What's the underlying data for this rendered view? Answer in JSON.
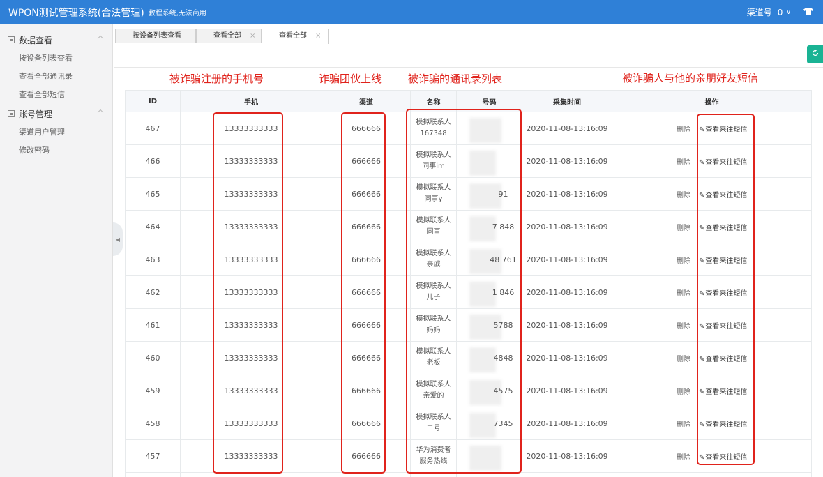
{
  "header": {
    "title": "WPON测试管理系统(合法管理)",
    "subtitle": "教程系统,无法商用",
    "channel_label": "渠道号",
    "channel_value": "0",
    "chevron": "∨"
  },
  "sidebar": {
    "groups": [
      {
        "label": "数据查看",
        "items": [
          "按设备列表查看",
          "查看全部通讯录",
          "查看全部短信"
        ]
      },
      {
        "label": "账号管理",
        "items": [
          "渠道用户管理",
          "修改密码"
        ]
      }
    ]
  },
  "tabs": [
    {
      "label": "按设备列表查看"
    },
    {
      "label": "查看全部",
      "close": "×"
    },
    {
      "label": "查看全部",
      "close": "×"
    }
  ],
  "annotations": {
    "phone": "被诈骗注册的手机号",
    "channel": "诈骗团伙上线",
    "contacts": "被诈骗的通讯录列表",
    "sms": "被诈骗人与他的亲朋好友短信"
  },
  "table": {
    "headers": [
      "ID",
      "手机",
      "渠道",
      "名称",
      "号码",
      "采集时间",
      "操作"
    ],
    "delete_label": "删除",
    "view_label": "查看来往短信",
    "rows": [
      {
        "id": "467",
        "phone": "13333333333",
        "channel": "666666",
        "name_1": "模拟联系人",
        "name_2": "167348",
        "number": "",
        "time": "2020-11-08-13:16:09"
      },
      {
        "id": "466",
        "phone": "13333333333",
        "channel": "666666",
        "name_1": "模拟联系人",
        "name_2": "同事im",
        "number": "",
        "time": "2020-11-08-13:16:09"
      },
      {
        "id": "465",
        "phone": "13333333333",
        "channel": "666666",
        "name_1": "模拟联系人",
        "name_2": "同事y",
        "number": "91",
        "time": "2020-11-08-13:16:09"
      },
      {
        "id": "464",
        "phone": "13333333333",
        "channel": "666666",
        "name_1": "模拟联系人",
        "name_2": "同事",
        "number": "7 848",
        "time": "2020-11-08-13:16:09"
      },
      {
        "id": "463",
        "phone": "13333333333",
        "channel": "666666",
        "name_1": "模拟联系人",
        "name_2": "亲戚",
        "number": "48 761",
        "time": "2020-11-08-13:16:09"
      },
      {
        "id": "462",
        "phone": "13333333333",
        "channel": "666666",
        "name_1": "模拟联系人",
        "name_2": "儿子",
        "number": "1 846",
        "time": "2020-11-08-13:16:09"
      },
      {
        "id": "461",
        "phone": "13333333333",
        "channel": "666666",
        "name_1": "模拟联系人",
        "name_2": "妈妈",
        "number": "5788",
        "time": "2020-11-08-13:16:09"
      },
      {
        "id": "460",
        "phone": "13333333333",
        "channel": "666666",
        "name_1": "模拟联系人",
        "name_2": "老板",
        "number": "4848",
        "time": "2020-11-08-13:16:09"
      },
      {
        "id": "459",
        "phone": "13333333333",
        "channel": "666666",
        "name_1": "模拟联系人",
        "name_2": "亲爱的",
        "number": "4575",
        "time": "2020-11-08-13:16:09"
      },
      {
        "id": "458",
        "phone": "13333333333",
        "channel": "666666",
        "name_1": "模拟联系人",
        "name_2": "二号",
        "number": "7345",
        "time": "2020-11-08-13:16:09"
      },
      {
        "id": "457",
        "phone": "13333333333",
        "channel": "666666",
        "name_1": "华为消费者",
        "name_2": "服务热线",
        "number": "",
        "time": "2020-11-08-13:16:09"
      }
    ]
  },
  "colors": {
    "topbar": "#2f80d7",
    "accent_green": "#1ab394",
    "annotation_red": "#e0231c"
  },
  "icons": {
    "refresh": "refresh-icon",
    "shirt": "shirt-icon",
    "pen": "pencil-icon"
  }
}
